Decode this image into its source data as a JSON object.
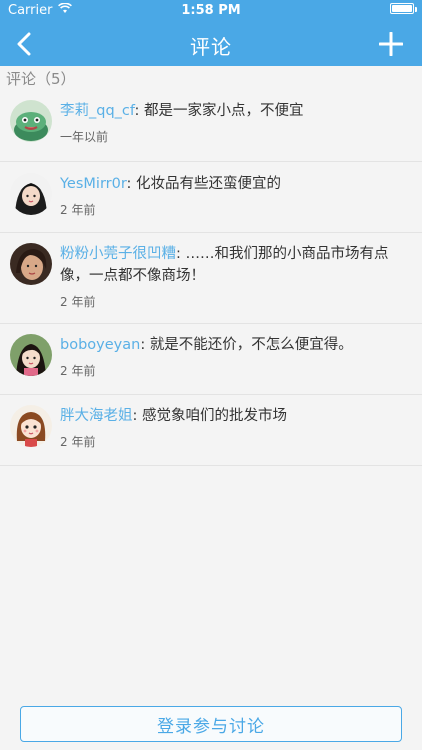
{
  "status": {
    "carrier": "Carrier",
    "time": "1:58 PM"
  },
  "nav": {
    "title": "评论",
    "back_icon": "chevron-left-icon",
    "add_icon": "plus-icon"
  },
  "section": {
    "title": "评论（5）"
  },
  "comments": [
    {
      "user": "李莉_qq_cf",
      "sep": ": ",
      "text": "都是一家家小点，不便宜",
      "time": "一年以前"
    },
    {
      "user": "YesMirr0r",
      "sep": ": ",
      "text": "化妆品有些还蛮便宜的",
      "time": "2 年前"
    },
    {
      "user": "粉粉小莞子很凹糟",
      "sep": ": ",
      "text": "……和我们那的小商品市场有点像，一点都不像商场！",
      "time": "2 年前"
    },
    {
      "user": "boboyeyan",
      "sep": ": ",
      "text": "就是不能还价，不怎么便宜得。",
      "time": "2 年前"
    },
    {
      "user": "胖大海老姐",
      "sep": ": ",
      "text": "感觉象咱们的批发市场",
      "time": "2 年前"
    }
  ],
  "footer": {
    "login_label": "登录参与讨论"
  },
  "colors": {
    "accent": "#4aa8e6",
    "username": "#5ab0e6"
  }
}
